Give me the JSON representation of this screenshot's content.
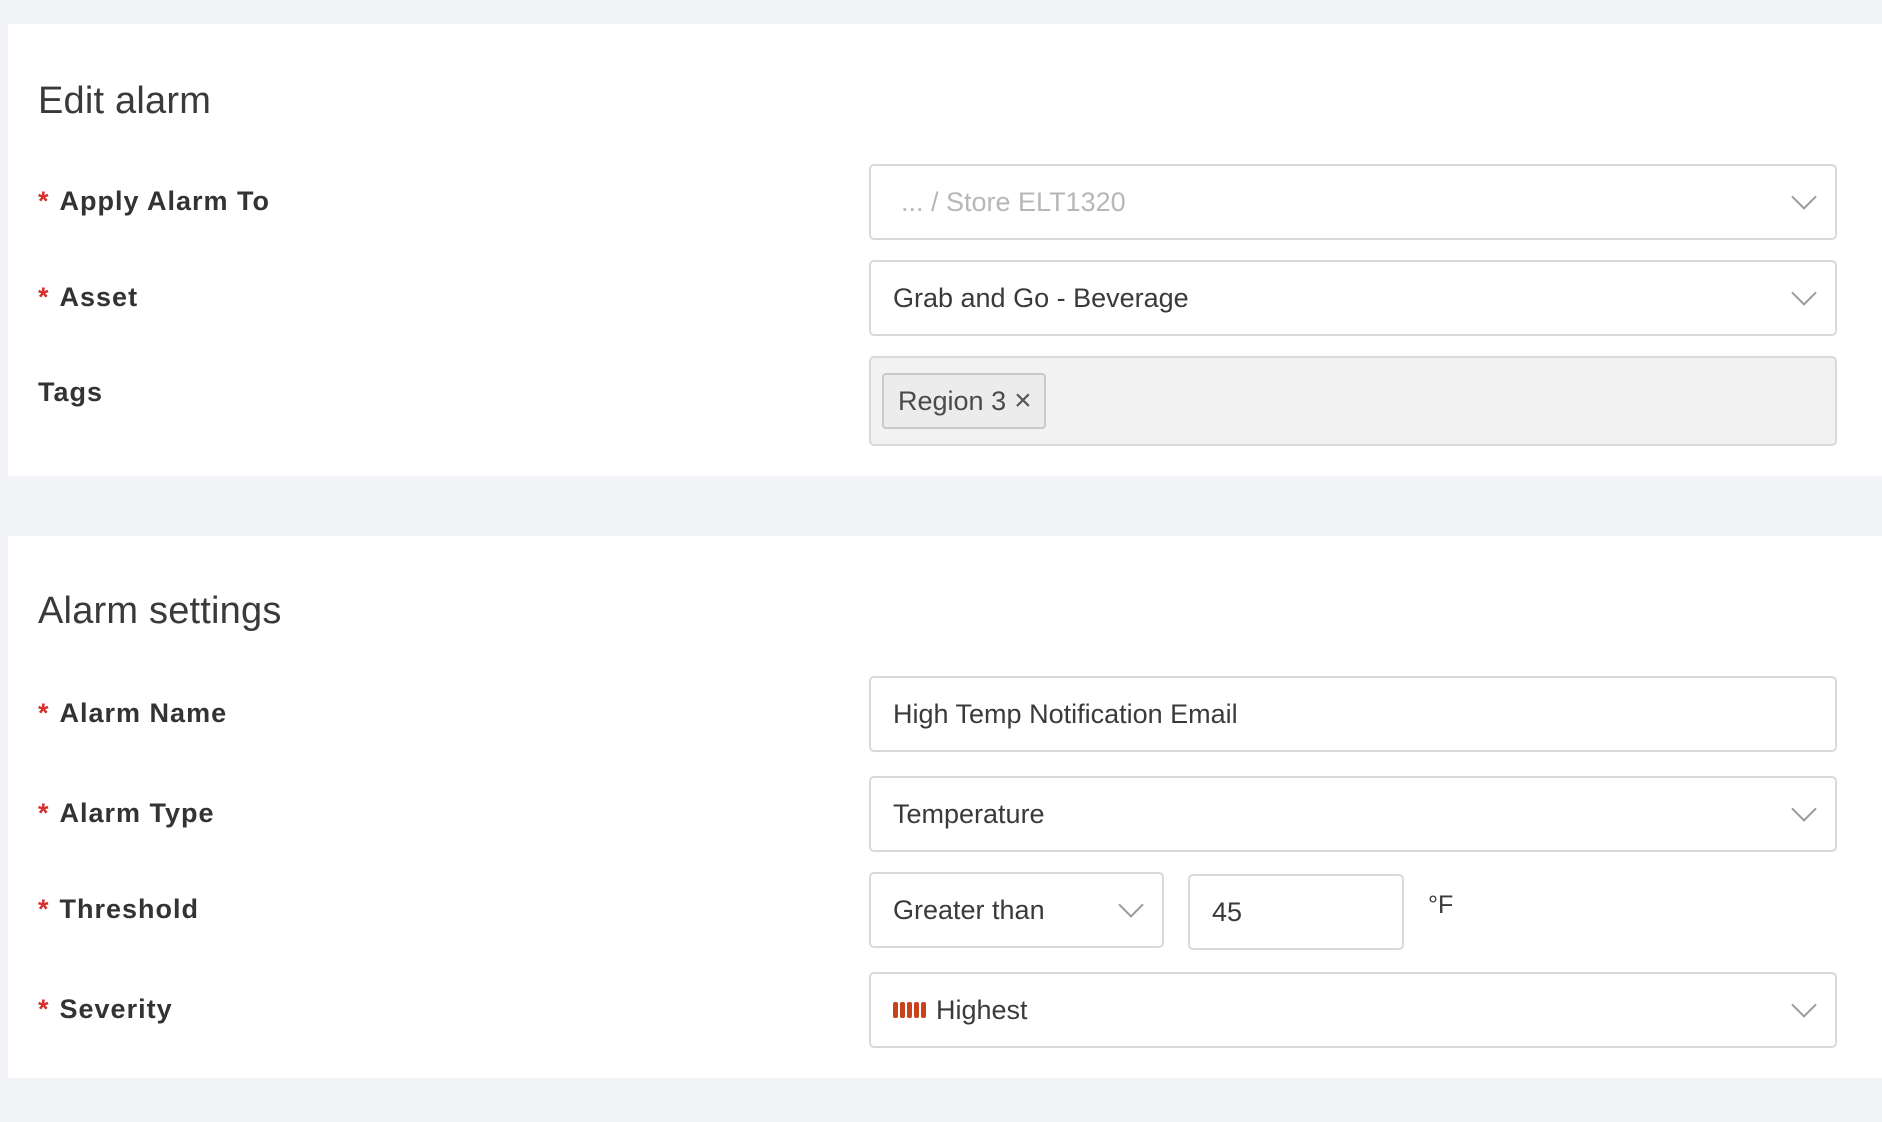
{
  "edit_section": {
    "title": "Edit alarm",
    "apply_alarm_to": {
      "label": "Apply Alarm To",
      "required": "*",
      "placeholder": "... / Store ELT1320"
    },
    "asset": {
      "label": "Asset",
      "required": "*",
      "value": "Grab and Go - Beverage"
    },
    "tags": {
      "label": "Tags",
      "items": [
        {
          "label": "Region 3",
          "remove": "×"
        }
      ]
    }
  },
  "settings_section": {
    "title": "Alarm settings",
    "alarm_name": {
      "label": "Alarm Name",
      "required": "*",
      "value": "High Temp Notification Email"
    },
    "alarm_type": {
      "label": "Alarm Type",
      "required": "*",
      "value": "Temperature"
    },
    "threshold": {
      "label": "Threshold",
      "required": "*",
      "operator": "Greater than",
      "value": "45",
      "unit": "°F"
    },
    "severity": {
      "label": "Severity",
      "required": "*",
      "value": "Highest",
      "icon": "severity-bars-icon",
      "color": "#c9421e"
    }
  },
  "colors": {
    "required": "#d32f2f",
    "background": "#f3f4f7",
    "card": "#ffffff"
  }
}
